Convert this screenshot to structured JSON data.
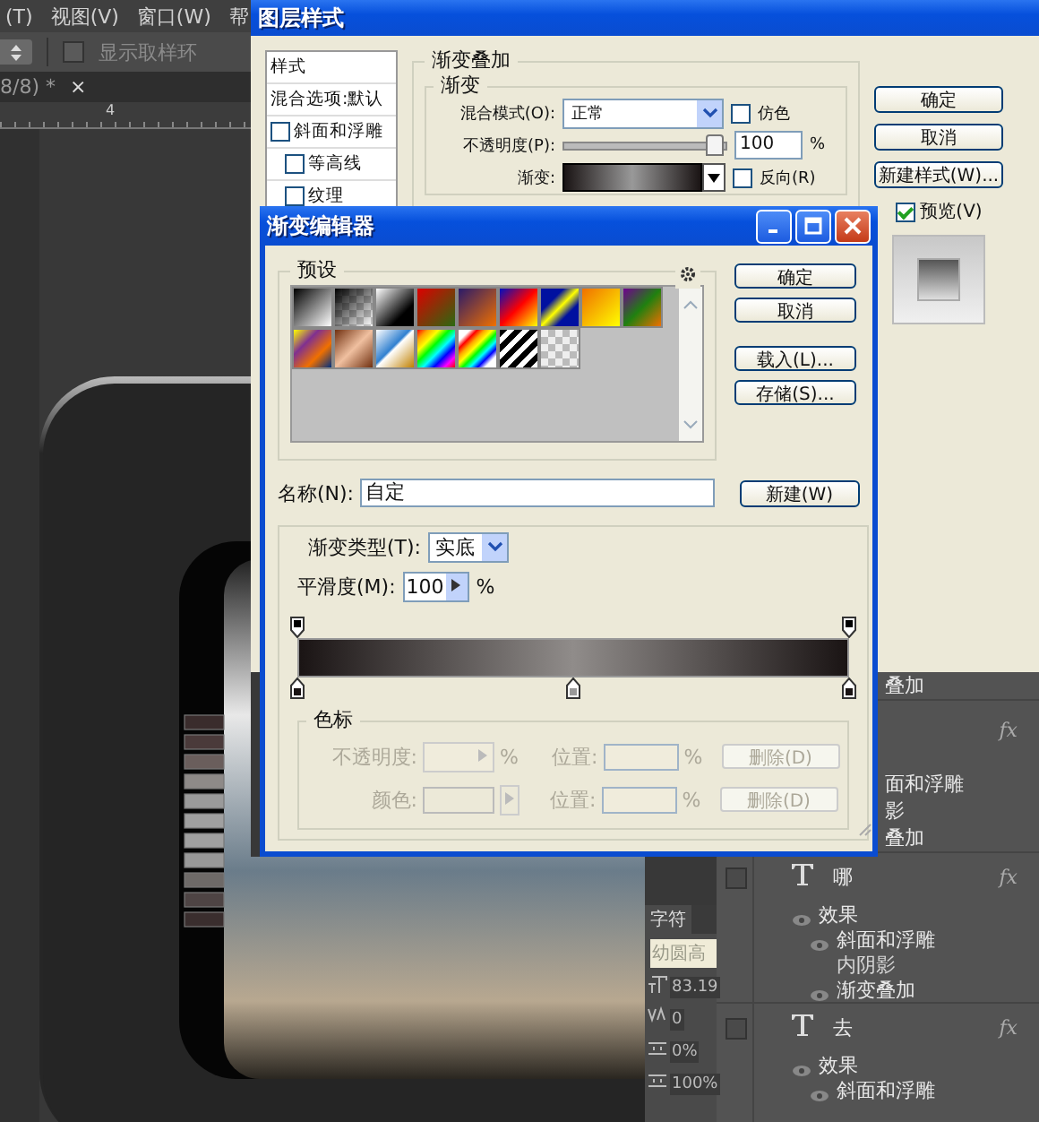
{
  "menu_bar": {
    "items": [
      "(T)",
      "视图(V)",
      "窗口(W)",
      "帮"
    ]
  },
  "options_bar": {
    "sample_ring": {
      "label": "显示取样环",
      "checked": false
    }
  },
  "document_tab": {
    "title": "8/8) *",
    "close": "×"
  },
  "ruler": {
    "tick_label": "4"
  },
  "layer_style_dialog": {
    "title": "图层样式",
    "styles_list": [
      {
        "label": "样式",
        "kind": "header"
      },
      {
        "label": "混合选项:默认",
        "kind": "item"
      },
      {
        "label": "斜面和浮雕",
        "kind": "check",
        "checked": false
      },
      {
        "label": "等高线",
        "kind": "subcheck",
        "checked": false
      },
      {
        "label": "纹理",
        "kind": "subcheck",
        "checked": false
      }
    ],
    "section_title": "渐变叠加",
    "group_title": "渐变",
    "blend_mode": {
      "label": "混合模式(O):",
      "value": "正常"
    },
    "dither": {
      "label": "仿色",
      "checked": false
    },
    "opacity": {
      "label": "不透明度(P):",
      "level": 1,
      "value": "100",
      "unit": "%"
    },
    "gradient": {
      "label": "渐变:"
    },
    "reverse": {
      "label": "反向(R)",
      "checked": false
    },
    "buttons": [
      "确定",
      "取消",
      "新建样式(W)..."
    ],
    "preview": {
      "label": "预览(V)",
      "checked": true
    }
  },
  "gradient_editor": {
    "title": "渐变编辑器",
    "presets_title": "预设",
    "buttons": [
      "确定",
      "取消",
      "载入(L)...",
      "存储(S)..."
    ],
    "name_field": {
      "label": "名称(N):",
      "value": "自定"
    },
    "new_button": "新建(W)",
    "gradient_type": {
      "label": "渐变类型(T):",
      "value": "实底"
    },
    "smoothness": {
      "label": "平滑度(M):",
      "value": "100",
      "unit": "%"
    },
    "stops_group": {
      "title": "色标",
      "disabled": true,
      "rows": [
        {
          "kind": "opacity",
          "label": "不透明度:",
          "unit": "%",
          "position_label": "位置:",
          "position_unit": "%",
          "delete": "删除(D)"
        },
        {
          "kind": "color",
          "label": "颜色:",
          "position_label": "位置:",
          "position_unit": "%",
          "delete": "删除(D)"
        }
      ]
    }
  },
  "layers_panel": {
    "rows": [
      {
        "kind": "effect-partial",
        "label": "叠加"
      },
      {
        "kind": "layer-partial",
        "fx": "fx"
      },
      {
        "kind": "effect-partial",
        "label": "面和浮雕"
      },
      {
        "kind": "effect-partial",
        "label": "影"
      },
      {
        "kind": "effect-partial",
        "label": "叠加"
      },
      {
        "kind": "layer",
        "name": "哪",
        "fx": "fx"
      },
      {
        "kind": "group",
        "label": "效果",
        "visible": true
      },
      {
        "kind": "effect",
        "label": "斜面和浮雕",
        "visible": true
      },
      {
        "kind": "effect",
        "label": "内阴影",
        "visible": false
      },
      {
        "kind": "effect",
        "label": "渐变叠加",
        "visible": true
      },
      {
        "kind": "layer",
        "name": "去",
        "fx": "fx"
      },
      {
        "kind": "group",
        "label": "效果",
        "visible": true
      },
      {
        "kind": "effect",
        "label": "斜面和浮雕",
        "visible": true
      }
    ]
  },
  "character_panel": {
    "tabs": [
      {
        "label": "字符",
        "selected": true
      }
    ],
    "font": "幼圆高",
    "fields": [
      {
        "kind": "size",
        "value": "83.19"
      },
      {
        "kind": "kerning",
        "value": "0"
      },
      {
        "kind": "tracking",
        "value": "0%"
      },
      {
        "kind": "scale",
        "value": "100%"
      }
    ]
  }
}
